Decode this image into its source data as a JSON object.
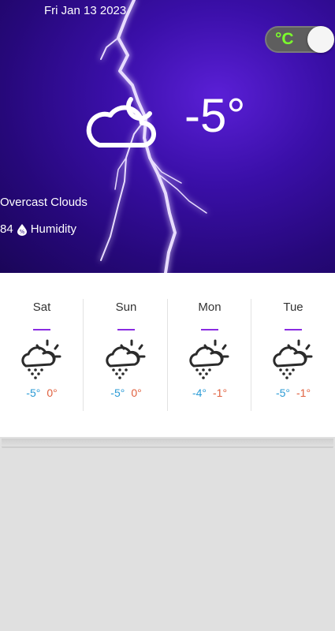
{
  "header": {
    "date": "Fri Jan 13 2023",
    "unit_toggle": "°C",
    "current_temp": "-5°",
    "condition": "Overcast Clouds",
    "humidity_value": "84",
    "humidity_label": "Humidity"
  },
  "forecast": [
    {
      "day": "Sat",
      "low": "-5°",
      "high": "0°",
      "icon": "snow-rain-sun-icon"
    },
    {
      "day": "Sun",
      "low": "-5°",
      "high": "0°",
      "icon": "snow-rain-sun-icon"
    },
    {
      "day": "Mon",
      "low": "-4°",
      "high": "-1°",
      "icon": "snow-rain-sun-icon"
    },
    {
      "day": "Tue",
      "low": "-5°",
      "high": "-1°",
      "icon": "snow-rain-sun-icon"
    }
  ],
  "colors": {
    "accent": "#8a2be2",
    "low_temp": "#2b9bd6",
    "high_temp": "#e0603e",
    "toggle_text": "#7cff2c"
  }
}
